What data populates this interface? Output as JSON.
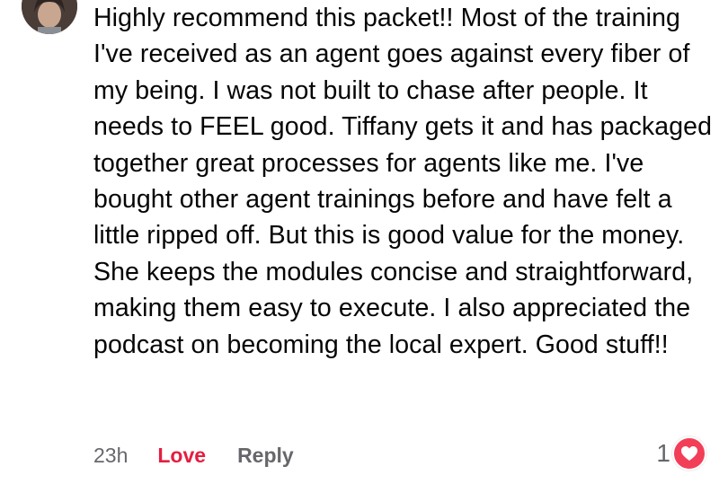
{
  "comment": {
    "text": "Highly recommend this packet!! Most of the training I've received as an agent goes against every fiber of my being. I was not built to chase after people. It needs to FEEL good. Tiffany gets it and has packaged together great processes for agents like me. I've bought other agent trainings before and have felt a little ripped off. But this is good value for the money. She keeps the modules concise and straightforward, making them easy to execute. I also appreciated the podcast on becoming the local expert. Good stuff!!",
    "timestamp": "23h",
    "love_label": "Love",
    "reply_label": "Reply",
    "reaction_count": "1",
    "reaction_icon": "heart-icon",
    "colors": {
      "love": "#e41e3f",
      "meta": "#65676b",
      "heart_badge": "#f33e58"
    }
  }
}
